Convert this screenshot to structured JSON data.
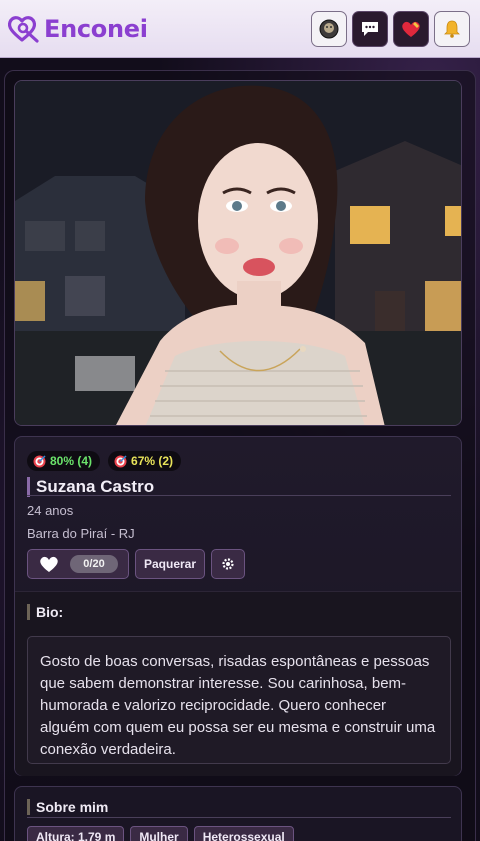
{
  "header": {
    "logo_text": "Enconei",
    "brand_color": "#8b3fd0",
    "buttons": [
      {
        "icon": "avatar-icon",
        "style": "light"
      },
      {
        "icon": "chat-icon",
        "style": "dark"
      },
      {
        "icon": "heart-icon",
        "style": "dark"
      },
      {
        "icon": "bell-icon",
        "style": "light"
      }
    ]
  },
  "profile": {
    "photo_icon": "profile-photo",
    "badges": [
      {
        "icon": "target-icon",
        "value": "80% (4)",
        "color": "#6be36b"
      },
      {
        "icon": "target-icon",
        "value": "67% (2)",
        "color": "#e8e35a"
      }
    ],
    "name": "Suzana Castro",
    "age": "24 anos",
    "city": "Barra do Piraí - RJ",
    "likes_count": "0/20",
    "flirt_label": "Paquerar",
    "bio_title": "Bio:",
    "bio_text": "Gosto de boas conversas, risadas espontâneas e pessoas que sabem demonstrar interesse. Sou carinhosa, bem-humorada e valorizo reciprocidade. Quero conhecer alguém com quem eu possa ser eu mesma e construir uma conexão verdadeira."
  },
  "about": {
    "title": "Sobre mim",
    "tags": [
      "Altura: 1,79 m",
      "Mulher",
      "Heterossexual"
    ]
  }
}
